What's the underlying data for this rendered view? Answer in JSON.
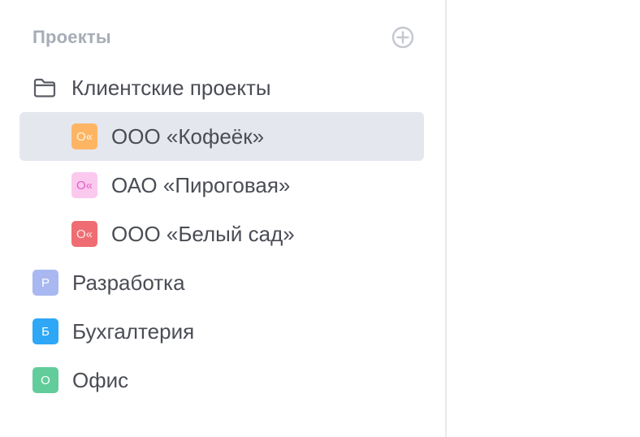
{
  "sidebar": {
    "section_title": "Проекты",
    "folder": {
      "label": "Клиентские проекты",
      "icon": "folder-icon"
    },
    "client_projects": [
      {
        "label": "ООО «Кофеёк»",
        "badge": "О«",
        "badge_bg": "#fdb563",
        "badge_fg": "#fff3e2",
        "selected": true
      },
      {
        "label": "ОАО «Пироговая»",
        "badge": "О«",
        "badge_bg": "#fbc8ee",
        "badge_fg": "#e35fc3",
        "selected": false
      },
      {
        "label": "ООО «Белый сад»",
        "badge": "О«",
        "badge_bg": "#ef6d72",
        "badge_fg": "#fde6e7",
        "selected": false
      }
    ],
    "projects": [
      {
        "label": "Разработка",
        "badge": "Р",
        "badge_bg": "#a9b8f1",
        "badge_fg": "#ffffff"
      },
      {
        "label": "Бухгалтерия",
        "badge": "Б",
        "badge_bg": "#2ea7f7",
        "badge_fg": "#ffffff"
      },
      {
        "label": "Офис",
        "badge": "О",
        "badge_bg": "#62cc9b",
        "badge_fg": "#ffffff"
      }
    ]
  },
  "colors": {
    "selected_row_bg": "#e4e7ee",
    "label_text": "#4a4d55",
    "section_title": "#a7acb6"
  }
}
